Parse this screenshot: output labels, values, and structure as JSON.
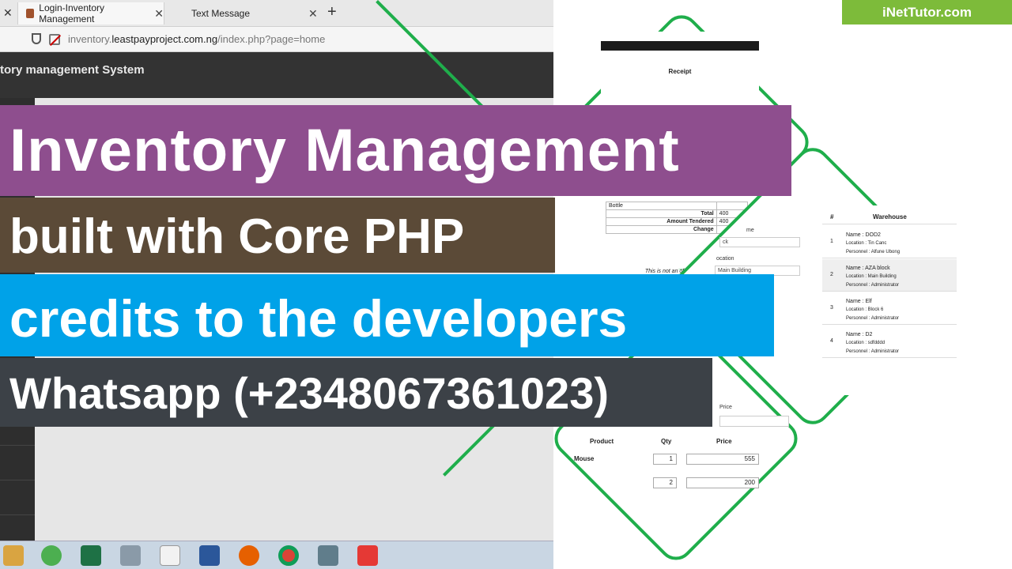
{
  "browser": {
    "tabs": [
      {
        "label": "Login-Inventory Management"
      },
      {
        "label": "Text Message"
      }
    ],
    "new_tab_symbol": "+",
    "close_symbol": "✕",
    "url_plain": "inventory.",
    "url_domain": "leastpayproject.com.ng",
    "url_path": "/index.php?page=home"
  },
  "app": {
    "title": "tory management System"
  },
  "banners": {
    "line1": "Inventory Management",
    "line2": "built with Core PHP",
    "line3": "credits to the developers",
    "line4": "Whatsapp (+2348067361023)"
  },
  "brand": "iNetTutor.com",
  "receipt": {
    "title": "Receipt",
    "item": "Bottle",
    "rows": [
      {
        "label": "Total",
        "value": "400"
      },
      {
        "label": "Amount Tendered",
        "value": "400"
      },
      {
        "label": "Change",
        "value": ""
      }
    ],
    "note": "This is not an official receipt."
  },
  "warehouse": {
    "col_num": "#",
    "col_name": "Warehouse",
    "rows": [
      {
        "num": "1",
        "name": "Name : DOD2",
        "location": "Location : Tin Canc",
        "personnel": "Personnel : Alfune Ubong"
      },
      {
        "num": "2",
        "name": "Name : AZA block",
        "location": "Location : Main Building",
        "personnel": "Personnel : Administrator"
      },
      {
        "num": "3",
        "name": "Name : Elf",
        "location": "Location : Block 6",
        "personnel": "Personnel : Administrator"
      },
      {
        "num": "4",
        "name": "Name : D2",
        "location": "Location : sdfdddd",
        "personnel": "Personnel : Administrator"
      }
    ]
  },
  "warehouse_form": {
    "label_name": "me",
    "name_value": "ck",
    "label_location": "ocation",
    "location_value": "Main Building"
  },
  "product_form": {
    "price_label": "Price",
    "col_product": "Product",
    "col_qty": "Qty",
    "col_price": "Price",
    "rows": [
      {
        "product": "Mouse",
        "qty": "1",
        "price": "555"
      },
      {
        "product": "",
        "qty": "2",
        "price": "200"
      }
    ]
  },
  "colors": {
    "accent_green": "#1fae4b",
    "banner1": "#8e4e8e",
    "banner2": "#5b4a37",
    "banner3": "#00a2e8",
    "banner4": "#3c4147",
    "brand": "#7dbb3a"
  },
  "taskbar_icons": [
    "explorer-icon",
    "edge-icon",
    "excel-icon",
    "camera-icon",
    "notepad-icon",
    "word-icon",
    "firefox-icon",
    "chrome-icon",
    "calculator-icon",
    "download-icon"
  ]
}
